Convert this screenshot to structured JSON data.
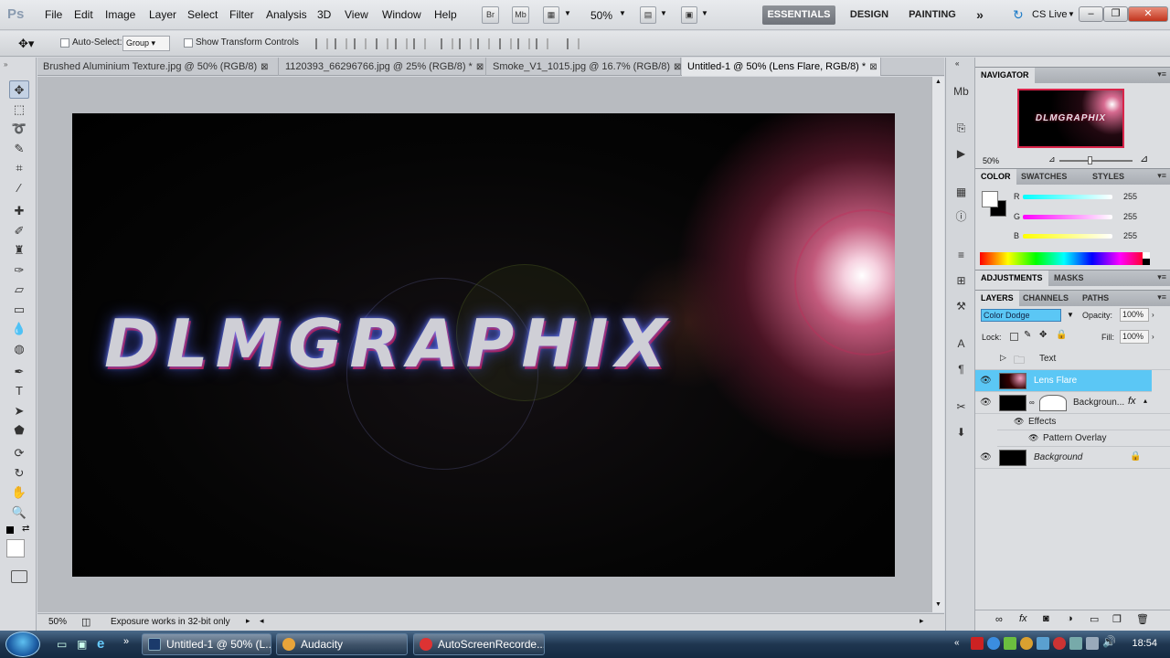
{
  "app": {
    "logo": "Ps"
  },
  "menu": [
    "File",
    "Edit",
    "Image",
    "Layer",
    "Select",
    "Filter",
    "Analysis",
    "3D",
    "View",
    "Window",
    "Help"
  ],
  "appbar": {
    "br_label": "Br",
    "mb_label": "Mb",
    "zoom": "50%"
  },
  "workspaces": [
    "ESSENTIALS",
    "DESIGN",
    "PAINTING"
  ],
  "cslive": "CS Live",
  "options": {
    "auto_select_label": "Auto-Select:",
    "auto_select_value": "Group",
    "show_transform_label": "Show Transform Controls"
  },
  "tabs": [
    {
      "label": "Brushed Aluminium Texture.jpg @ 50% (RGB/8)",
      "active": false
    },
    {
      "label": "1120393_66296766.jpg @ 25% (RGB/8) *",
      "active": false
    },
    {
      "label": "Smoke_V1_1015.jpg @ 16.7% (RGB/8)",
      "active": false
    },
    {
      "label": "Untitled-1 @ 50% (Lens Flare, RGB/8) *",
      "active": true
    }
  ],
  "canvas": {
    "text": "DLMGRAPHIX"
  },
  "status": {
    "zoom": "50%",
    "message": "Exposure works in 32-bit only"
  },
  "navigator": {
    "title": "NAVIGATOR",
    "zoom": "50%",
    "thumb_text": "DLMGRAPHIX"
  },
  "color_panel": {
    "tabs": [
      "COLOR",
      "SWATCHES",
      "STYLES"
    ],
    "r_label": "R",
    "g_label": "G",
    "b_label": "B",
    "r": "255",
    "g": "255",
    "b": "255"
  },
  "adjustments": {
    "tabs": [
      "ADJUSTMENTS",
      "MASKS"
    ]
  },
  "layers_panel": {
    "tabs": [
      "LAYERS",
      "CHANNELS",
      "PATHS"
    ],
    "blend_mode": "Color Dodge",
    "opacity_label": "Opacity:",
    "opacity": "100%",
    "lock_label": "Lock:",
    "fill_label": "Fill:",
    "fill": "100%",
    "layers": [
      {
        "name": "Text"
      },
      {
        "name": "Lens Flare"
      },
      {
        "name": "Backgroun..."
      },
      {
        "name": "Effects"
      },
      {
        "name": "Pattern Overlay"
      },
      {
        "name": "Background"
      }
    ]
  },
  "taskbar": {
    "tasks": [
      {
        "label": "Untitled-1 @ 50% (L..."
      },
      {
        "label": "Audacity"
      },
      {
        "label": "AutoScreenRecorde..."
      }
    ],
    "clock": "18:54"
  },
  "colors": {
    "accent": "#5bc7f5",
    "essentials_bg": "#7a7e85",
    "close_red": "#c2341c"
  }
}
